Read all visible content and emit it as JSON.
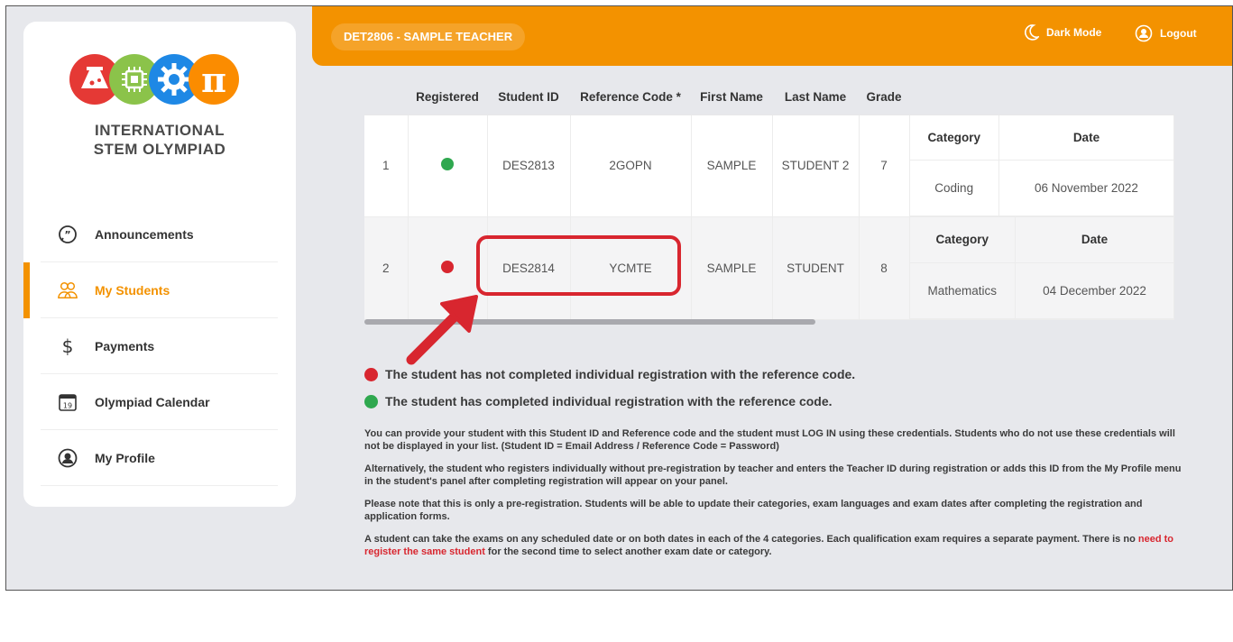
{
  "header": {
    "teacher_label": "DET2806 - SAMPLE TEACHER",
    "dark_mode_label": "Dark Mode",
    "logout_label": "Logout",
    "accent_color": "#f39200"
  },
  "brand": {
    "line1": "INTERNATIONAL",
    "line2": "STEM OLYMPIAD",
    "logo_letters": "π"
  },
  "sidebar": {
    "items": [
      {
        "label": "Announcements",
        "icon": "chat-bubble-icon",
        "active": false
      },
      {
        "label": "My Students",
        "icon": "users-icon",
        "active": true
      },
      {
        "label": "Payments",
        "icon": "dollar-icon",
        "active": false
      },
      {
        "label": "Olympiad Calendar",
        "icon": "calendar-icon",
        "active": false,
        "icon_text": "19"
      },
      {
        "label": "My Profile",
        "icon": "user-circle-icon",
        "active": false
      }
    ]
  },
  "table": {
    "headers": {
      "index": "",
      "registered": "Registered",
      "student_id": "Student ID",
      "reference_code": "Reference Code *",
      "first_name": "First Name",
      "last_name": "Last Name",
      "grade": "Grade",
      "category": "Category",
      "date": "Date"
    },
    "rows": [
      {
        "index": "1",
        "registered": "green",
        "student_id": "DES2813",
        "reference_code": "2GOPN",
        "first_name": "SAMPLE",
        "last_name": "STUDENT 2",
        "grade": "7",
        "category": "Coding",
        "date": "06 November 2022"
      },
      {
        "index": "2",
        "registered": "red",
        "student_id": "DES2814",
        "reference_code": "YCMTE",
        "first_name": "SAMPLE",
        "last_name": "STUDENT",
        "grade": "8",
        "category": "Mathematics",
        "date": "04 December 2022"
      }
    ]
  },
  "legend": {
    "not_completed": "The student has not completed individual registration with the reference code.",
    "completed": "The student has completed individual registration with the reference code.",
    "red_color": "#d8262f",
    "green_color": "#2fa84f"
  },
  "notes": {
    "p1": "You can provide your student with this Student ID and Reference code and the student must LOG IN using these credentials. Students who do not use these credentials will not be displayed in your list. (Student ID = Email Address / Reference Code = Password)",
    "p2": "Alternatively, the student who registers individually without pre-registration by teacher and enters the Teacher ID during registration or adds this ID from the My Profile menu in the student's panel after completing registration will appear on your panel.",
    "p3": "Please note that this is only a pre-registration. Students will be able to update their categories, exam languages and exam dates after completing the registration and application forms.",
    "p4_start": "A student can take the exams on any scheduled date or on both dates in each of the 4 categories. Each qualification exam requires a separate payment. There is no ",
    "p4_red": "need to register the same student",
    "p4_end": " for the second time to select another exam date or category."
  }
}
